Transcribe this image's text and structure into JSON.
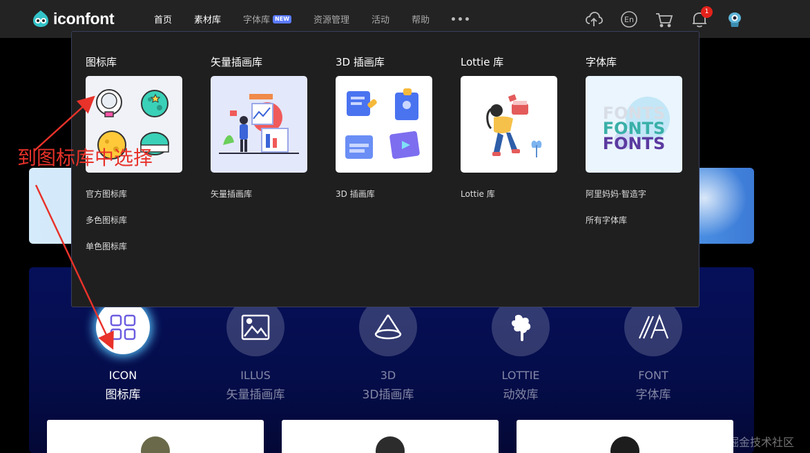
{
  "header": {
    "logo_text": "iconfont",
    "nav": [
      {
        "label": "首页",
        "active": true
      },
      {
        "label": "素材库",
        "active": true
      },
      {
        "label": "字体库",
        "active": false,
        "badge": "NEW"
      },
      {
        "label": "资源管理",
        "active": false
      },
      {
        "label": "活动",
        "active": false
      },
      {
        "label": "帮助",
        "active": false
      }
    ],
    "lang_label": "En",
    "notification_count": "1"
  },
  "dropdown": {
    "columns": [
      {
        "title": "图标库",
        "links": [
          "官方图标库",
          "多色图标库",
          "单色图标库"
        ]
      },
      {
        "title": "矢量插画库",
        "links": [
          "矢量插画库"
        ]
      },
      {
        "title": "3D 插画库",
        "links": [
          "3D 插画库"
        ]
      },
      {
        "title": "Lottie 库",
        "links": [
          "Lottie 库"
        ]
      },
      {
        "title": "字体库",
        "links": [
          "阿里妈妈·智造字",
          "所有字体库"
        ]
      }
    ],
    "font_preview": [
      "FONTS",
      "FONTS",
      "FONTS"
    ]
  },
  "categories": [
    {
      "en": "ICON",
      "zh": "图标库",
      "active": true
    },
    {
      "en": "ILLUS",
      "zh": "矢量插画库",
      "active": false
    },
    {
      "en": "3D",
      "zh": "3D插画库",
      "active": false
    },
    {
      "en": "LOTTIE",
      "zh": "动效库",
      "active": false
    },
    {
      "en": "FONT",
      "zh": "字体库",
      "active": false
    }
  ],
  "annotation": {
    "text": "到图标库中选择"
  },
  "watermark": "@稀土掘金技术社区",
  "colors": {
    "accent": "#5b7bff",
    "annotation": "#e8322a",
    "badge": "#e3221b"
  }
}
